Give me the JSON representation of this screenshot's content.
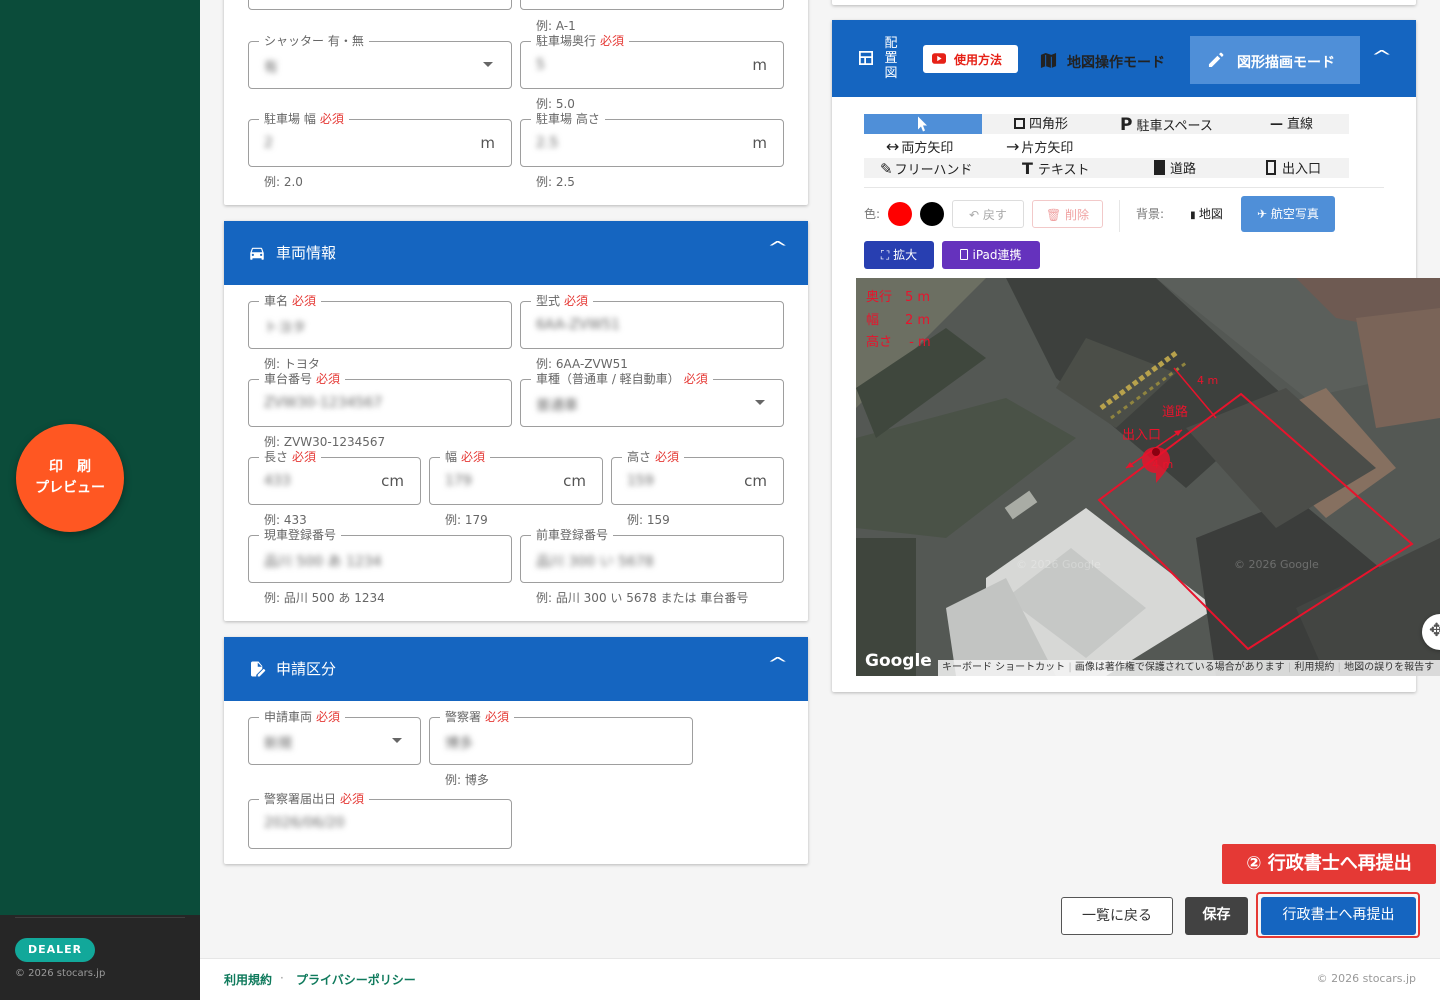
{
  "sidebar": {
    "badge": "DEALER",
    "copyright": "© 2026 stocars.jp",
    "preview_line1": "印刷",
    "preview_line2": "プレビュー"
  },
  "top_section": {
    "top_field_hint": "例: A-1",
    "shutter": {
      "label": "シャッター 有・無",
      "value": "有"
    },
    "parking_depth": {
      "label": "駐車場奥行",
      "required": "必須",
      "value": "5",
      "unit": "m",
      "hint": "例: 5.0"
    },
    "parking_width": {
      "label": "駐車場 幅",
      "required": "必須",
      "value": "2",
      "unit": "m",
      "hint": "例: 2.0"
    },
    "parking_height": {
      "label": "駐車場 高さ",
      "value": "2.5",
      "unit": "m",
      "hint": "例: 2.5"
    }
  },
  "vehicle": {
    "title": "車両情報",
    "name": {
      "label": "車名",
      "required": "必須",
      "value": "トヨタ",
      "hint": "例: トヨタ"
    },
    "model": {
      "label": "型式",
      "required": "必須",
      "value": "6AA-ZVW51",
      "hint": "例: 6AA-ZVW51"
    },
    "chassis": {
      "label": "車台番号",
      "required": "必須",
      "value": "ZVW30-1234567",
      "hint": "例: ZVW30-1234567"
    },
    "type": {
      "label": "車種（普通車 / 軽自動車）",
      "required": "必須",
      "value": "普通車"
    },
    "length": {
      "label": "長さ",
      "required": "必須",
      "value": "433",
      "unit": "cm",
      "hint": "例: 433"
    },
    "width": {
      "label": "幅",
      "required": "必須",
      "value": "179",
      "unit": "cm",
      "hint": "例: 179"
    },
    "height": {
      "label": "高さ",
      "required": "必須",
      "value": "159",
      "unit": "cm",
      "hint": "例: 159"
    },
    "current_reg": {
      "label": "現車登録番号",
      "value": "品川 500 あ 1234",
      "hint": "例: 品川 500 あ 1234"
    },
    "previous_reg": {
      "label": "前車登録番号",
      "value": "品川 300 い 5678",
      "hint": "例: 品川 300 い 5678 または 車台番号"
    }
  },
  "application": {
    "title": "申請区分",
    "vehicle": {
      "label": "申請車両",
      "required": "必須",
      "value": "新規"
    },
    "police": {
      "label": "警察署",
      "required": "必須",
      "value": "博多",
      "hint": "例: 博多"
    },
    "date": {
      "label": "警察署届出日",
      "required": "必須",
      "value": "2026/06/20"
    }
  },
  "layout_panel": {
    "title_chars": [
      "配",
      "置",
      "図"
    ],
    "howto": "使用方法",
    "mode_map": "地図操作モード",
    "mode_draw": "図形描画モード",
    "tools": {
      "rect": "四角形",
      "parking": "駐車スペース",
      "line": "直線",
      "double_arrow": "両方矢印",
      "single_arrow": "片方矢印",
      "freehand": "フリーハンド",
      "text": "テキスト",
      "road": "道路",
      "entrance": "出入口"
    },
    "color_label": "色:",
    "colors": [
      "#ff0000",
      "#000000"
    ],
    "undo": "戻す",
    "delete": "削除",
    "bg_label": "背景:",
    "bg_map": "地図",
    "bg_aerial": "航空写真",
    "expand": "拡大",
    "ipad": "iPad連携"
  },
  "map": {
    "legend_depth": "奥行　5 m",
    "legend_width": "幅　　2 m",
    "legend_height": "高さ　 - m",
    "dim_4m_top": "4 m",
    "road": "道路",
    "entrance": "出入口",
    "dim_4m_side": "4 m",
    "google": "Google",
    "watermark": "© 2026 Google",
    "attribution": [
      "キーボード ショートカット",
      "画像は著作権で保護されている場合があります",
      "利用規約",
      "地図の誤りを報告す"
    ]
  },
  "callout": "② 行政書士へ再提出",
  "actions": {
    "back": "一覧に戻る",
    "save": "保存",
    "resubmit": "行政書士へ再提出"
  },
  "footer": {
    "terms": "利用規約",
    "sep": "·",
    "privacy": "プライバシーポリシー",
    "copyright": "© 2026 stocars.jp"
  }
}
